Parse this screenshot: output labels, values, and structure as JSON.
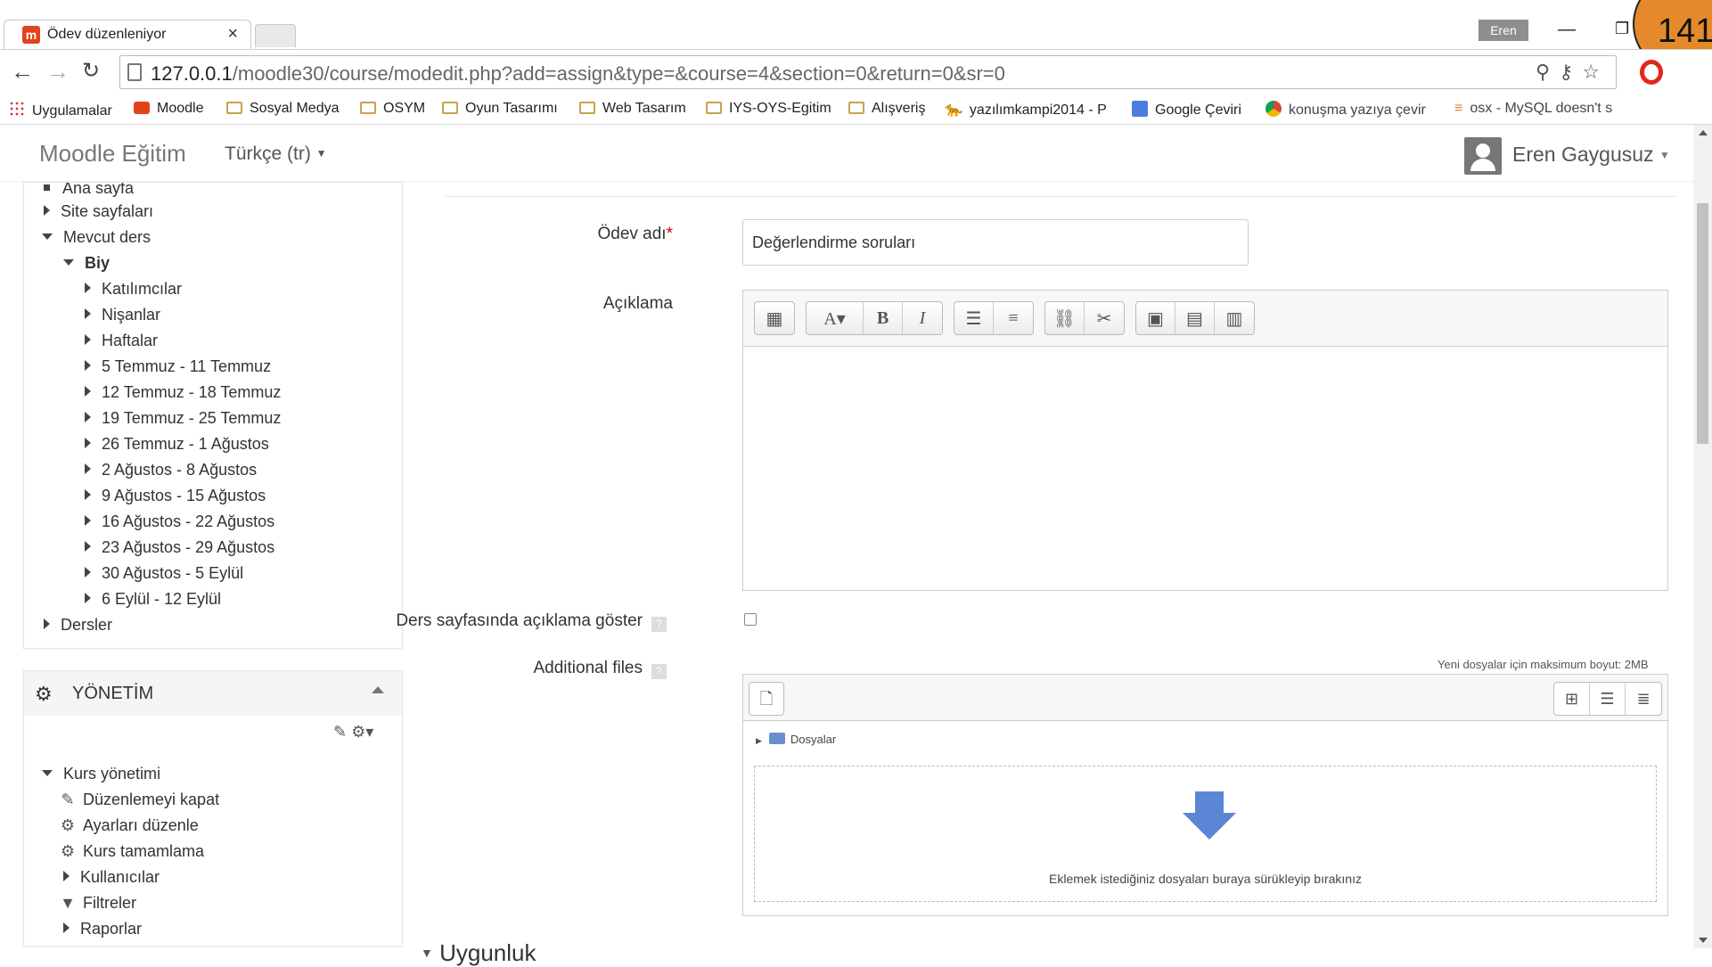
{
  "browser": {
    "tab_title": "Ödev düzenleniyor",
    "tab_close": "×",
    "profile": "Eren",
    "counter": "141",
    "url_host": "127.0.0.1",
    "url_path": "/moodle30/course/modedit.php?add=assign&type=&course=4&section=0&return=0&sr=0",
    "bookmarks": [
      "Uygulamalar",
      "Moodle",
      "Sosyal Medya",
      "OSYM",
      "Oyun Tasarımı",
      "Web Tasarım",
      "IYS-OYS-Egitim",
      "Alışveriş",
      "yazılımkampi2014 - P",
      "Google Çeviri",
      "konuşma yazıya çevir",
      "osx - MySQL doesn't s"
    ]
  },
  "navbar": {
    "brand": "Moodle Eğitim",
    "language": "Türkçe (tr)",
    "user": "Eren Gaygusuz"
  },
  "nav_tree": {
    "items": [
      "Ana sayfa",
      "Site sayfaları",
      "Mevcut ders",
      "Biy",
      "Katılımcılar",
      "Nişanlar",
      "Haftalar",
      "5 Temmuz - 11 Temmuz",
      "12 Temmuz - 18 Temmuz",
      "19 Temmuz - 25 Temmuz",
      "26 Temmuz - 1 Ağustos",
      "2 Ağustos - 8 Ağustos",
      "9 Ağustos - 15 Ağustos",
      "16 Ağustos - 22 Ağustos",
      "23 Ağustos - 29 Ağustos",
      "30 Ağustos - 5 Eylül",
      "6 Eylül - 12 Eylül",
      "Dersler"
    ]
  },
  "admin": {
    "title": "YÖNETİM",
    "items": [
      "Kurs yönetimi",
      "Düzenlemeyi kapat",
      "Ayarları düzenle",
      "Kurs tamamlama",
      "Kullanıcılar",
      "Filtreler",
      "Raporlar"
    ]
  },
  "form": {
    "name_label": "Ödev adı",
    "required_mark": "*",
    "name_value": "Değerlendirme soruları",
    "description_label": "Açıklama",
    "show_desc_label": "Ders sayfasında açıklama göster",
    "files_label": "Additional files",
    "max_size": "Yeni dosyalar için maksimum boyut: 2MB",
    "folder_label": "Dosyalar",
    "drop_text": "Eklemek istediğiniz dosyaları buraya sürükleyip bırakınız",
    "next_section": "Uygunluk"
  },
  "colors": {
    "accent_orange": "#e58a2a",
    "moodle_red": "#e2421c",
    "drop_arrow": "#5b86d6"
  }
}
